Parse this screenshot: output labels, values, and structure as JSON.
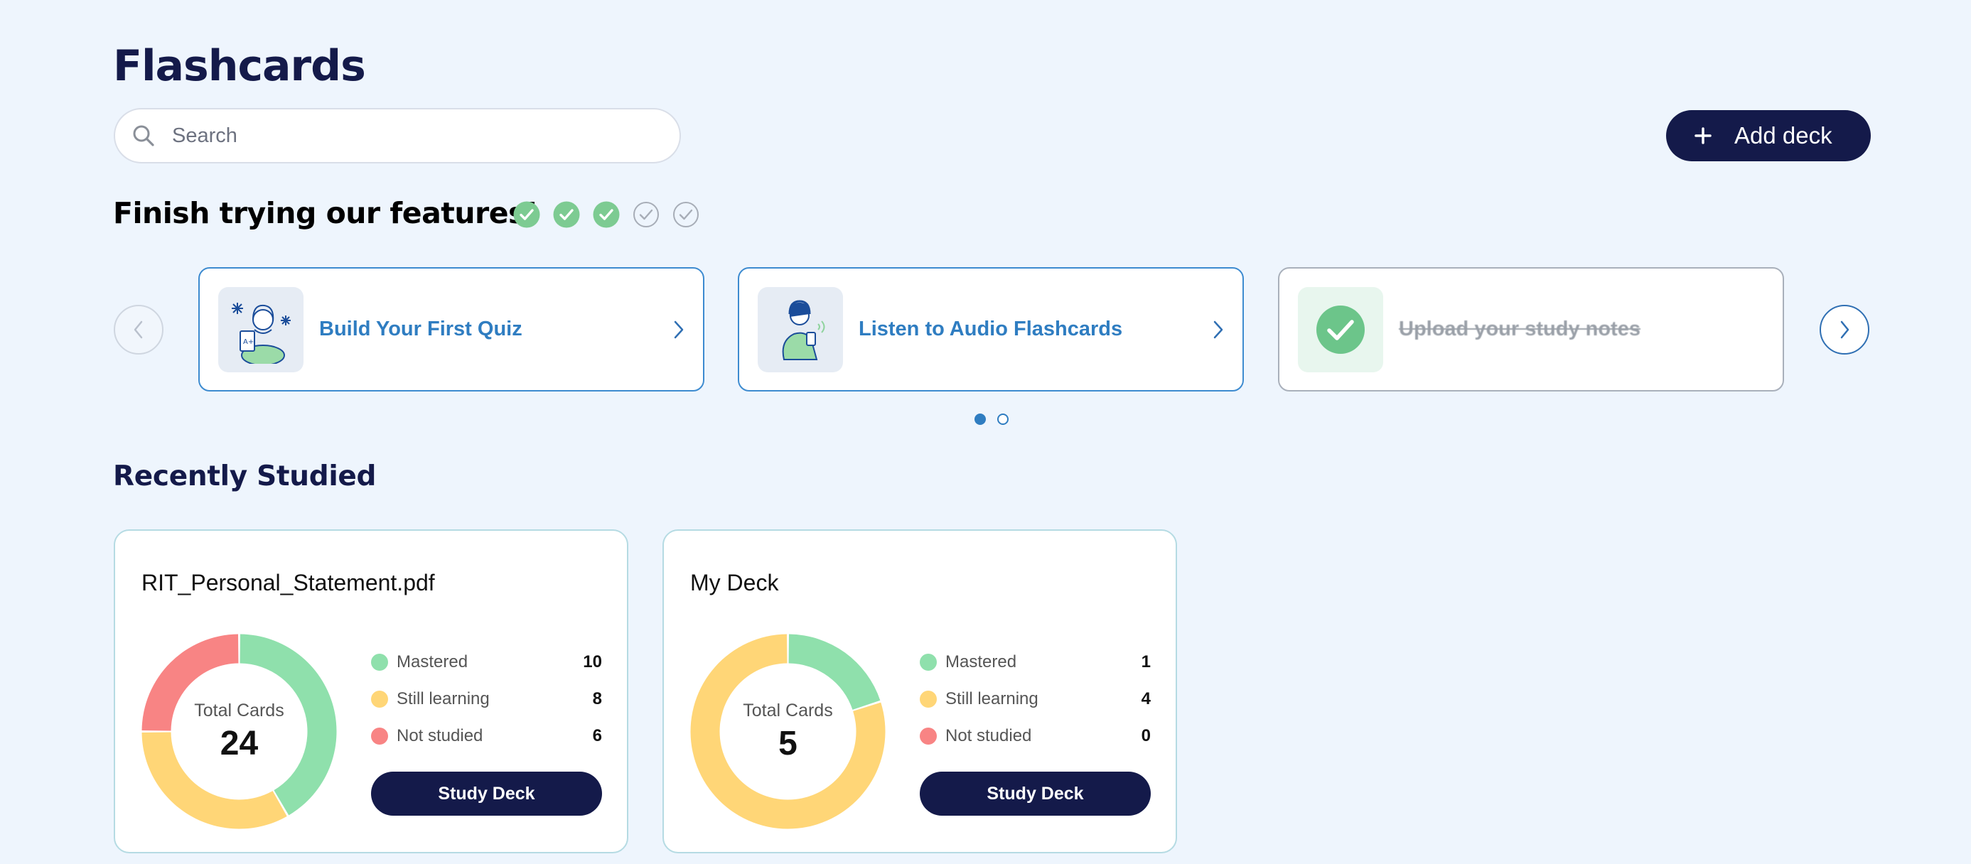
{
  "header": {
    "title": "Flashcards",
    "search_placeholder": "Search",
    "add_deck_label": "Add deck"
  },
  "features": {
    "title": "Finish trying our features!",
    "progress": {
      "completed": 3,
      "total": 5
    },
    "cards": [
      {
        "label": "Build Your First Quiz",
        "status": "todo",
        "icon": "quiz-illustration-icon"
      },
      {
        "label": "Listen to Audio Flashcards",
        "status": "todo",
        "icon": "audio-illustration-icon"
      },
      {
        "label": "Upload your study notes",
        "status": "done",
        "icon": "checkmark-icon"
      }
    ],
    "pagination": {
      "pages": 2,
      "current": 1
    }
  },
  "recent": {
    "title": "Recently Studied",
    "decks": [
      {
        "title": "RIT_Personal_Statement.pdf",
        "total_caption": "Total Cards",
        "total": 24,
        "mastered_label": "Mastered",
        "mastered": 10,
        "learning_label": "Still learning",
        "learning": 8,
        "not_studied_label": "Not studied",
        "not_studied": 6,
        "button_label": "Study Deck"
      },
      {
        "title": "My Deck",
        "total_caption": "Total Cards",
        "total": 5,
        "mastered_label": "Mastered",
        "mastered": 1,
        "learning_label": "Still learning",
        "learning": 4,
        "not_studied_label": "Not studied",
        "not_studied": 0,
        "button_label": "Study Deck"
      }
    ]
  },
  "colors": {
    "navy": "#141a4a",
    "accent_blue": "#2f7dc1",
    "mastered": "#8fe0ac",
    "learning": "#ffd677",
    "not_studied": "#f88484",
    "check_done": "#7dcb92",
    "background": "#eef5fd"
  }
}
